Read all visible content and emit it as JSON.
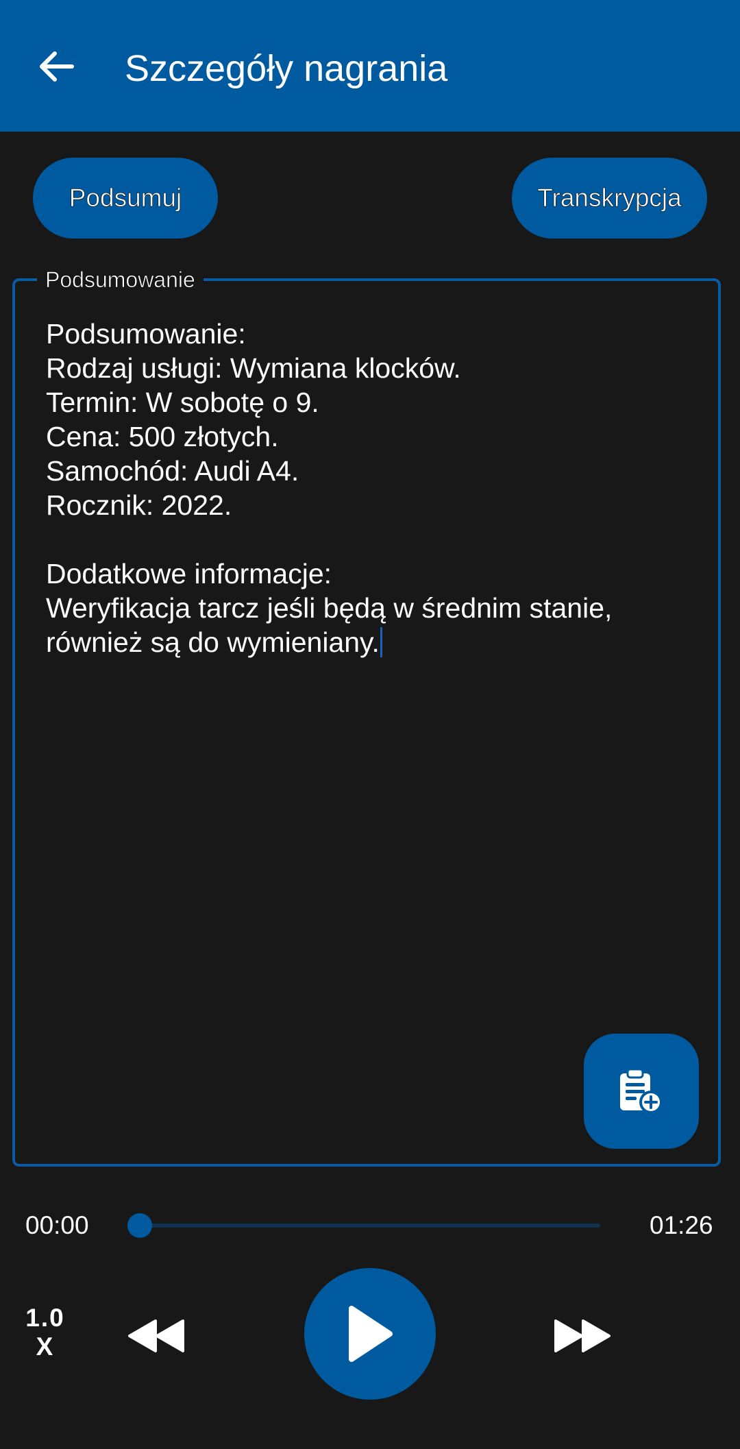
{
  "header": {
    "title": "Szczegóły nagrania",
    "back_icon": "arrow-back-icon"
  },
  "actions": {
    "summarize_label": "Podsumuj",
    "transcription_label": "Transkrypcja"
  },
  "summary": {
    "legend": "Podsumowanie",
    "text": "Podsumowanie:\nRodzaj usługi: Wymiana klocków.\nTermin: W sobotę o 9.\nCena: 500 złotych.\nSamochód: Audi A4.\nRocznik: 2022.\n\nDodatkowe informacje:\nWeryfikacja tarcz jeśli będą w średnim stanie, również są do wymieniany."
  },
  "fab": {
    "icon": "clipboard-add-icon"
  },
  "player": {
    "current_time": "00:00",
    "total_time": "01:26",
    "progress": 0.0,
    "speed_value": "1.0",
    "speed_suffix": "X",
    "rewind_icon": "rewind-icon",
    "play_icon": "play-icon",
    "forward_icon": "fast-forward-icon"
  },
  "colors": {
    "accent": "#005aa0",
    "background": "#181818",
    "border": "#0b5aa4",
    "text": "#ffffff"
  }
}
